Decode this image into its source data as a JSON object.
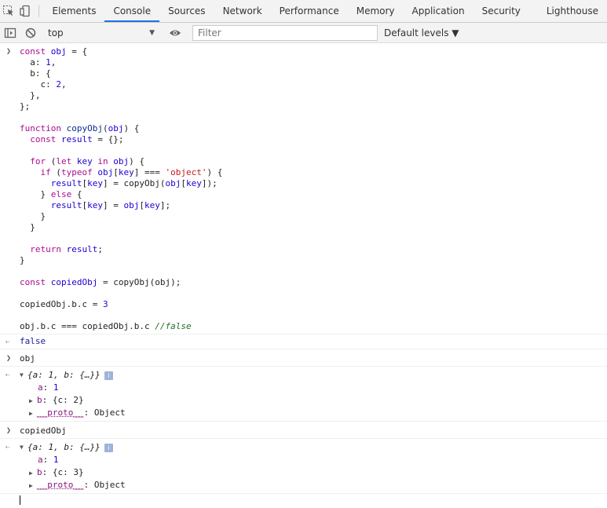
{
  "tabs": [
    "Elements",
    "Console",
    "Sources",
    "Network",
    "Performance",
    "Memory",
    "Application",
    "Security",
    "Lighthouse"
  ],
  "active_tab": "Console",
  "toolbar": {
    "context": "top",
    "filter_placeholder": "Filter",
    "levels": "Default levels ▼"
  },
  "input1": {
    "result": "false"
  },
  "input2": {
    "command": "obj",
    "preview": "{a: 1, b: {…}}",
    "props": {
      "a_key": "a",
      "a_val": "1",
      "b_key": "b",
      "b_val": "{c: 2}",
      "proto_key": "__proto__",
      "proto_val": "Object"
    }
  },
  "input3": {
    "command": "copiedObj",
    "preview": "{a: 1, b: {…}}",
    "props": {
      "a_key": "a",
      "a_val": "1",
      "b_key": "b",
      "b_val": "{c: 3}",
      "proto_key": "__proto__",
      "proto_val": "Object"
    }
  },
  "icons": {
    "inspect": "inspect-element-icon",
    "device": "device-toolbar-icon",
    "sidebar": "show-sidebar-icon",
    "clear": "clear-console-icon",
    "eye": "live-expression-eye-icon",
    "info": "info-icon"
  }
}
